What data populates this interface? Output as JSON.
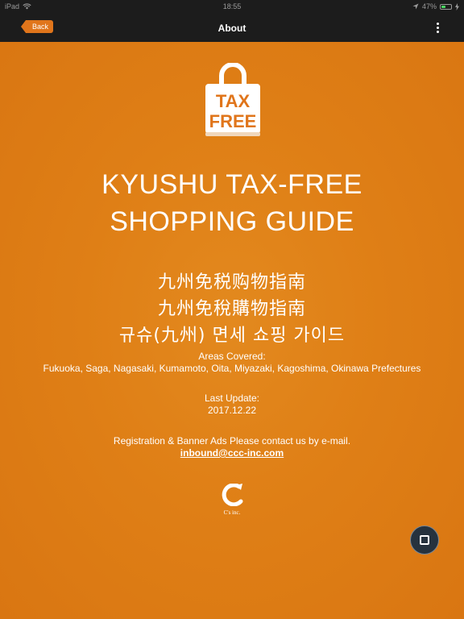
{
  "status_bar": {
    "device": "iPad",
    "time": "18:55",
    "battery": "47%",
    "battery_level": 0.47
  },
  "nav": {
    "back_label": "Back",
    "title": "About"
  },
  "logo": {
    "line1": "TAX",
    "line2": "FREE"
  },
  "title": {
    "line1": "KYUSHU TAX-FREE",
    "line2": "SHOPPING GUIDE"
  },
  "translations": {
    "simplified": "九州免税购物指南",
    "traditional": "九州免稅購物指南",
    "korean": "규슈(九州) 면세 쇼핑 가이드"
  },
  "areas": {
    "label": "Areas Covered:",
    "list": "Fukuoka, Saga, Nagasaki, Kumamoto, Oita, Miyazaki, Kagoshima, Okinawa Prefectures"
  },
  "update": {
    "label": "Last Update:",
    "date": "2017.12.22"
  },
  "contact": {
    "text": "Registration & Banner Ads Please contact us by e-mail.",
    "email": "inbound@ccc-inc.com"
  },
  "company": {
    "label": "C's inc."
  },
  "colors": {
    "brand_orange": "#df7f16",
    "back_button": "#e0751b",
    "bar": "#1c1c1c"
  },
  "icons": {
    "wifi": "wifi-icon",
    "location": "location-arrow-icon",
    "battery": "battery-icon",
    "charging": "charging-bolt-icon",
    "menu": "more-vertical-icon",
    "bag": "shopping-bag-icon",
    "company": "company-c-logo-icon",
    "floating": "stop-square-icon"
  }
}
